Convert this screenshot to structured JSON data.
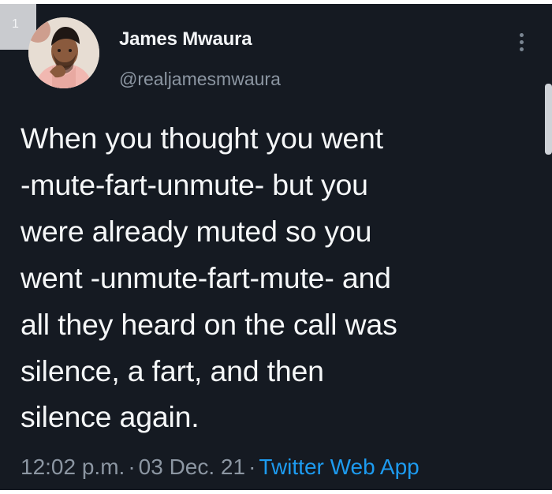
{
  "corner": {
    "number": "1"
  },
  "author": {
    "display_name": "James Mwaura",
    "handle": "@realjamesmwaura",
    "avatar_icon": "profile-photo"
  },
  "tweet": {
    "text": "When you thought you went\n-mute-fart-unmute- but you\nwere already muted so you\nwent -unmute-fart-mute- and\nall they heard on the call was\nsilence, a fart, and then\nsilence again."
  },
  "meta": {
    "time": "12:02 p.m.",
    "separator": "·",
    "date": "03 Dec. 21",
    "source": "Twitter Web App"
  },
  "colors": {
    "background": "#151a22",
    "primary_text": "#f5f7f8",
    "secondary_text": "#8c96a2",
    "link": "#1d9bf0"
  },
  "icons": {
    "menu": "more-vertical-icon"
  }
}
